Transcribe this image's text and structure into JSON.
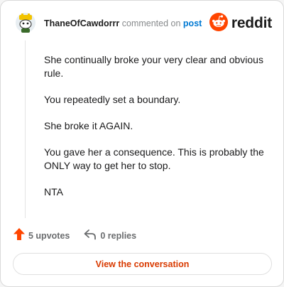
{
  "comment": {
    "username": "ThaneOfCawdorrr",
    "action_text": "commented on",
    "post_link": "post",
    "paragraphs": [
      "She continually broke your very clear and obvious rule.",
      "You repeatedly set a boundary.",
      "She broke it AGAIN.",
      "You gave her a consequence. This is probably the ONLY way to get her to stop.",
      "NTA"
    ]
  },
  "brand": {
    "name": "reddit",
    "icon": "reddit-logo-icon"
  },
  "actions": {
    "upvotes_label": "5 upvotes",
    "replies_label": "0 replies",
    "upvote_icon": "upvote-arrow-icon",
    "reply_icon": "reply-arrow-icon"
  },
  "cta": {
    "label": "View the conversation"
  },
  "colors": {
    "accent": "#ff4500",
    "link": "#0079d3",
    "cta_text": "#d93a00"
  }
}
